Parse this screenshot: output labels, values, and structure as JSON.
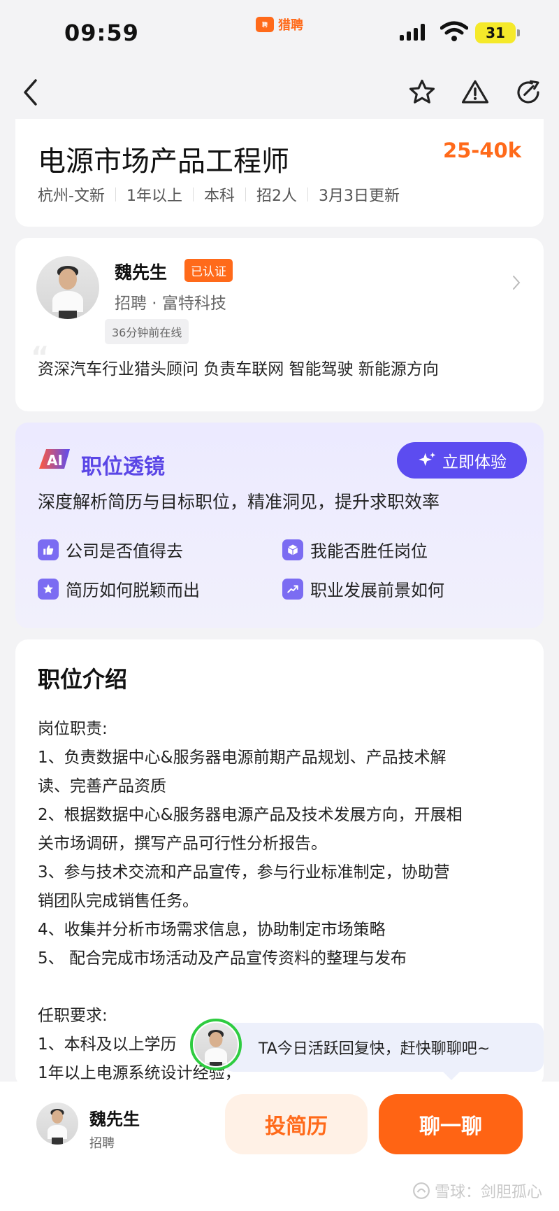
{
  "status_bar": {
    "time": "09:59",
    "app_name": "猎聘",
    "battery": "31"
  },
  "job": {
    "title": "电源市场产品工程师",
    "salary": "25-40k",
    "tags": [
      "杭州-文新",
      "1年以上",
      "本科",
      "招2人",
      "3月3日更新"
    ]
  },
  "recruiter": {
    "name": "魏先生",
    "verified_badge": "已认证",
    "subtitle": "招聘 · 富特科技",
    "online_status": "36分钟前在线",
    "intro": "资深汽车行业猎头顾问 负责车联网 智能驾驶 新能源方向"
  },
  "ai_lens": {
    "title": "职位透镜",
    "try_button": "立即体验",
    "description": "深度解析简历与目标职位，精准洞见，提升求职效率",
    "features": [
      "公司是否值得去",
      "我能否胜任岗位",
      "简历如何脱颖而出",
      "职业发展前景如何"
    ]
  },
  "job_intro": {
    "section_title": "职位介绍",
    "lines": [
      "岗位职责:",
      "1、负责数据中心&服务器电源前期产品规划、产品技术解",
      "读、完善产品资质",
      "2、根据数据中心&服务器电源产品及技术发展方向，开展相",
      "关市场调研，撰写产品可行性分析报告。",
      "3、参与技术交流和产品宣传，参与行业标准制定，协助营",
      "销团队完成销售任务。",
      "4、收集并分析市场需求信息，协助制定市场策略",
      "5、 配合完成市场活动及产品宣传资料的整理与发布",
      "",
      "任职要求:",
      "1、本科及以上学历",
      "1年以上电源系统设计经验，"
    ]
  },
  "chat_bubble": {
    "text": "TA今日活跃回复快，赶快聊聊吧~"
  },
  "bottom_bar": {
    "name": "魏先生",
    "role": "招聘",
    "resume_button": "投简历",
    "chat_button": "聊一聊"
  },
  "watermark": "雪球：剑胆孤心",
  "colors": {
    "accent": "#ff6a1a",
    "ai_purple": "#5c4cf0",
    "online_green": "#2ecc40"
  }
}
